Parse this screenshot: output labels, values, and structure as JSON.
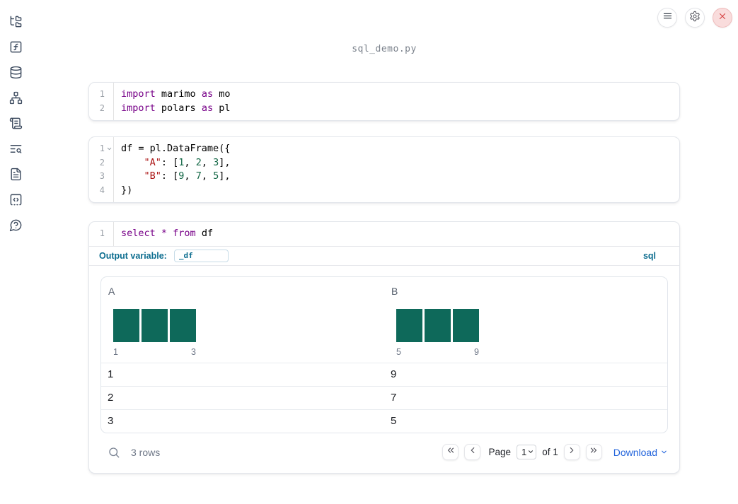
{
  "window": {
    "title": "sql_demo.py"
  },
  "topbar": {
    "buttons": [
      {
        "name": "notebook-menu",
        "icon": "menu-icon"
      },
      {
        "name": "settings",
        "icon": "gear-icon"
      },
      {
        "name": "shutdown",
        "icon": "close-icon"
      }
    ]
  },
  "sidebar": {
    "items": [
      {
        "name": "file-explorer",
        "icon": "folder-tree-icon"
      },
      {
        "name": "variables",
        "icon": "function-square-icon"
      },
      {
        "name": "data-sources",
        "icon": "database-icon"
      },
      {
        "name": "dependencies",
        "icon": "network-icon"
      },
      {
        "name": "logs",
        "icon": "scroll-text-icon"
      },
      {
        "name": "outline-search",
        "icon": "text-search-icon"
      },
      {
        "name": "documentation",
        "icon": "file-text-icon"
      },
      {
        "name": "snippets",
        "icon": "square-code-icon"
      },
      {
        "name": "help",
        "icon": "help-bubble-icon"
      }
    ]
  },
  "cells": [
    {
      "type": "code",
      "language": "python",
      "lines": [
        {
          "n": "1",
          "t": [
            [
              "kw",
              "import"
            ],
            [
              "pl",
              " marimo "
            ],
            [
              "kw",
              "as"
            ],
            [
              "pl",
              " mo"
            ]
          ]
        },
        {
          "n": "2",
          "t": [
            [
              "kw",
              "import"
            ],
            [
              "pl",
              " polars "
            ],
            [
              "kw",
              "as"
            ],
            [
              "pl",
              " pl"
            ]
          ]
        }
      ]
    },
    {
      "type": "code",
      "language": "python",
      "lines": [
        {
          "n": "1",
          "fold": true,
          "t": [
            [
              "pl",
              "df = pl.DataFrame({"
            ]
          ]
        },
        {
          "n": "2",
          "t": [
            [
              "pl",
              "    "
            ],
            [
              "str",
              "\"A\""
            ],
            [
              "pl",
              ": ["
            ],
            [
              "num",
              "1"
            ],
            [
              "pl",
              ", "
            ],
            [
              "num",
              "2"
            ],
            [
              "pl",
              ", "
            ],
            [
              "num",
              "3"
            ],
            [
              "pl",
              "],"
            ]
          ]
        },
        {
          "n": "3",
          "t": [
            [
              "pl",
              "    "
            ],
            [
              "str",
              "\"B\""
            ],
            [
              "pl",
              ": ["
            ],
            [
              "num",
              "9"
            ],
            [
              "pl",
              ", "
            ],
            [
              "num",
              "7"
            ],
            [
              "pl",
              ", "
            ],
            [
              "num",
              "5"
            ],
            [
              "pl",
              "],"
            ]
          ]
        },
        {
          "n": "4",
          "t": [
            [
              "pl",
              "})"
            ]
          ]
        }
      ]
    },
    {
      "type": "sql",
      "language_label": "sql",
      "output_variable_label": "Output variable:",
      "output_variable_value": "_df",
      "lines": [
        {
          "n": "1",
          "t": [
            [
              "kw",
              "select"
            ],
            [
              "kw",
              " * "
            ],
            [
              "kw",
              "from"
            ],
            [
              "pl",
              " df"
            ]
          ]
        }
      ]
    }
  ],
  "table": {
    "columns": [
      {
        "name": "A",
        "histogram": {
          "bars": [
            1,
            1,
            1
          ],
          "min_label": "1",
          "max_label": "3"
        }
      },
      {
        "name": "B",
        "histogram": {
          "bars": [
            1,
            1,
            1
          ],
          "min_label": "5",
          "max_label": "9"
        }
      }
    ],
    "rows": [
      [
        "1",
        "9"
      ],
      [
        "2",
        "7"
      ],
      [
        "3",
        "5"
      ]
    ],
    "footer": {
      "row_count": "3 rows",
      "page_label": "Page",
      "page_value": "1",
      "of_label": "of 1",
      "download_label": "Download"
    }
  },
  "colors": {
    "accent_blue": "#0c6d8f",
    "link_blue": "#2264dc",
    "histogram_teal": "#0e695a",
    "keyword": "#770088",
    "string": "#aa1111",
    "number": "#116644",
    "close_red": "#d64545"
  }
}
